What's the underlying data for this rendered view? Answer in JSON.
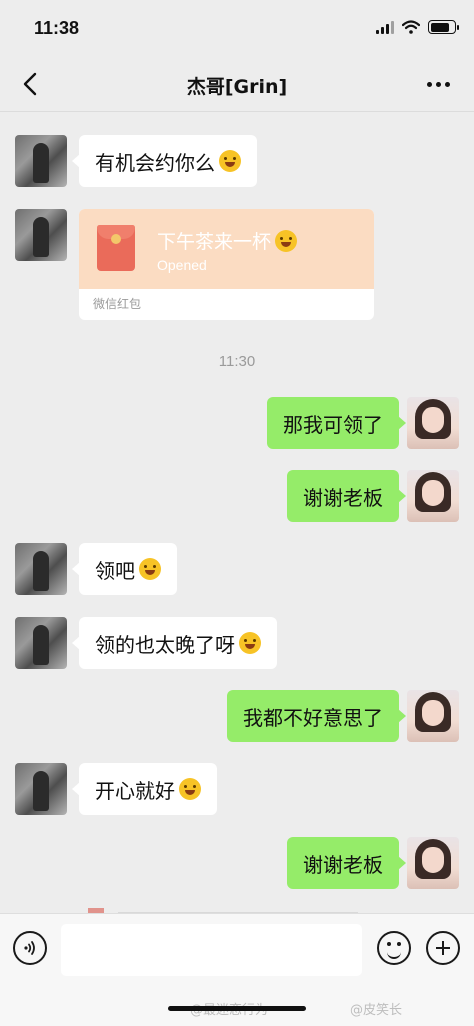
{
  "status_bar": {
    "time": "11:38"
  },
  "header": {
    "title": "杰哥[Grin]"
  },
  "messages": {
    "m1": {
      "text": "有机会约你么",
      "sender": "contact"
    },
    "red_packet": {
      "title": "下午茶来一杯",
      "status": "Opened",
      "footer": "微信红包",
      "sender": "contact"
    },
    "timestamp": "11:30",
    "m3": {
      "text": "那我可领了",
      "sender": "me"
    },
    "m4": {
      "text": "谢谢老板",
      "sender": "me"
    },
    "m5": {
      "text": "领吧",
      "sender": "contact"
    },
    "m6": {
      "text": "领的也太晚了呀",
      "sender": "contact"
    },
    "m7": {
      "text": "我都不好意思了",
      "sender": "me"
    },
    "m8": {
      "text": "开心就好",
      "sender": "contact"
    },
    "m9": {
      "text": "谢谢老板",
      "sender": "me"
    }
  },
  "input_bar": {
    "placeholder": ""
  },
  "watermarks": {
    "left": "@最迷恋行为",
    "right": "@皮笑长"
  },
  "colors": {
    "background": "#ededed",
    "outgoing_bubble": "#95ec69",
    "incoming_bubble": "#ffffff",
    "red_packet": "#fbdcc2"
  },
  "icons": [
    "back-icon",
    "more-icon",
    "voice-icon",
    "emoji-icon",
    "plus-icon",
    "signal-icon",
    "wifi-icon",
    "battery-icon"
  ]
}
